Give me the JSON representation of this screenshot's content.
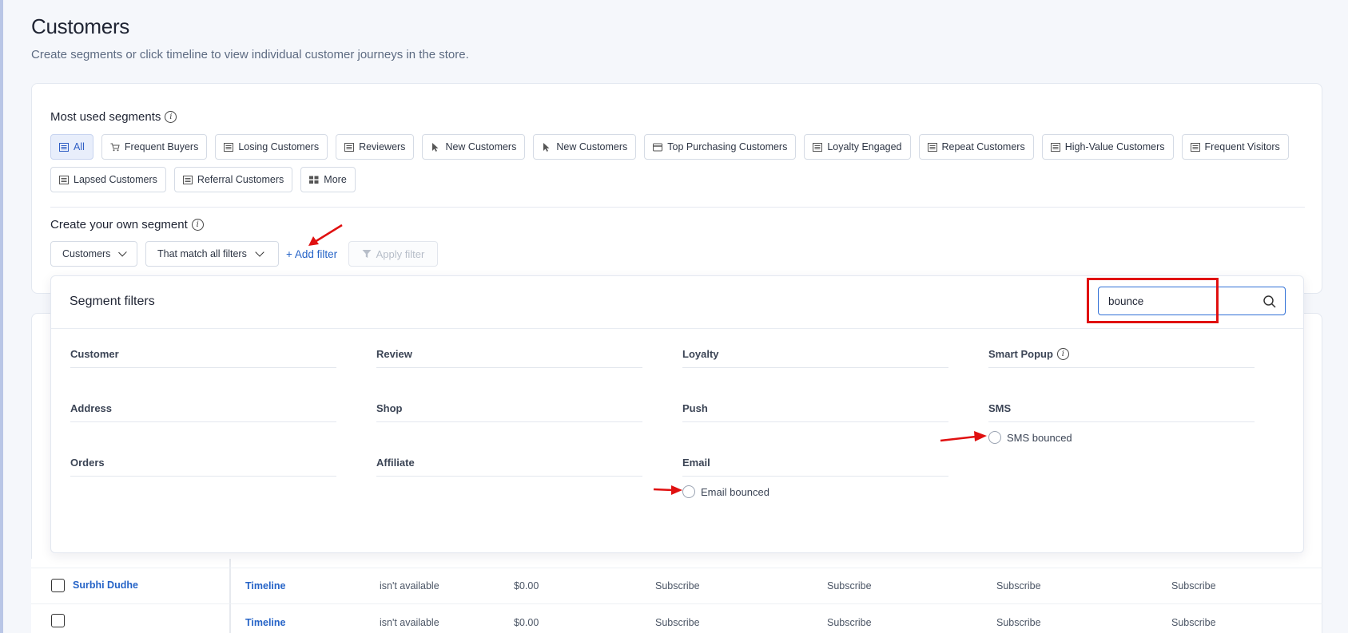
{
  "page": {
    "title": "Customers",
    "subtitle": "Create segments or click timeline to view individual customer journeys in the store."
  },
  "segments": {
    "title": "Most used segments",
    "chips": [
      {
        "label": "All",
        "icon": "list-icon",
        "active": true
      },
      {
        "label": "Frequent Buyers",
        "icon": "cart-icon"
      },
      {
        "label": "Losing Customers",
        "icon": "list-icon"
      },
      {
        "label": "Reviewers",
        "icon": "list-icon"
      },
      {
        "label": "New Customers",
        "icon": "cursor-icon"
      },
      {
        "label": "New Customers",
        "icon": "cursor-icon"
      },
      {
        "label": "Top Purchasing Customers",
        "icon": "card-icon"
      },
      {
        "label": "Loyalty Engaged",
        "icon": "list-icon"
      },
      {
        "label": "Repeat Customers",
        "icon": "list-icon"
      },
      {
        "label": "High-Value Customers",
        "icon": "list-icon"
      },
      {
        "label": "Frequent Visitors",
        "icon": "list-icon"
      },
      {
        "label": "Lapsed Customers",
        "icon": "list-icon"
      },
      {
        "label": "Referral Customers",
        "icon": "list-icon"
      },
      {
        "label": "More",
        "icon": "grid-icon"
      }
    ]
  },
  "create": {
    "title": "Create your own segment",
    "entity_select": "Customers",
    "match_select": "That match all filters",
    "add_filter": "+ Add filter",
    "apply_filter": "Apply filter"
  },
  "panel": {
    "title": "Segment filters",
    "search_value": "bounce",
    "groups": {
      "customer": "Customer",
      "review": "Review",
      "loyalty": "Loyalty",
      "smart_popup": "Smart Popup",
      "address": "Address",
      "shop": "Shop",
      "push": "Push",
      "sms": "SMS",
      "orders": "Orders",
      "affiliate": "Affiliate",
      "email": "Email"
    },
    "options": {
      "sms_bounced": "SMS bounced",
      "email_bounced": "Email bounced"
    }
  },
  "table": {
    "rows": [
      {
        "name": "Surbhi Dudhe",
        "timeline": "Timeline",
        "c1": "isn't available",
        "c2": "$0.00",
        "c3": "Subscribe",
        "c4": "Subscribe",
        "c5": "Subscribe",
        "c6": "Subscribe"
      },
      {
        "name": "",
        "timeline": "Timeline",
        "c1": "isn't available",
        "c2": "$0.00",
        "c3": "Subscribe",
        "c4": "Subscribe",
        "c5": "Subscribe",
        "c6": "Subscribe"
      }
    ]
  },
  "colors": {
    "accent": "#2563c7",
    "annotation": "#e01010"
  }
}
